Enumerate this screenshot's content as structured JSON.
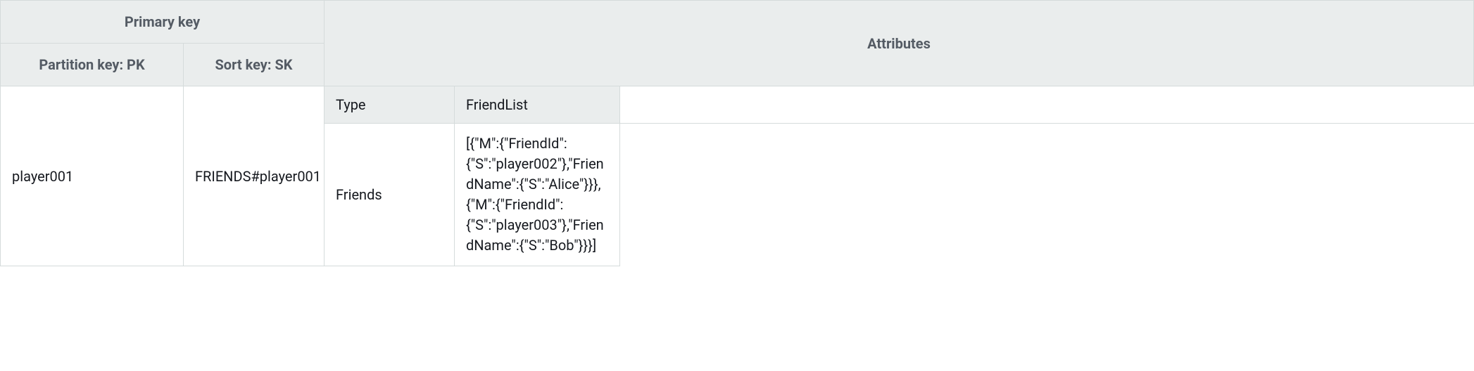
{
  "table": {
    "primary_key_header": "Primary key",
    "attributes_header": "Attributes",
    "partition_key_header": "Partition key: PK",
    "sort_key_header": "Sort key: SK",
    "attr_columns": {
      "type": "Type",
      "friendlist": "FriendList"
    },
    "row": {
      "pk": "player001",
      "sk": "FRIENDS#player001",
      "type": "Friends",
      "friendlist": "[{\"M\":{\"FriendId\":{\"S\":\"player002\"},\"FriendName\":{\"S\":\"Alice\"}}},{\"M\":{\"FriendId\":{\"S\":\"player003\"},\"FriendName\":{\"S\":\"Bob\"}}}]"
    }
  }
}
